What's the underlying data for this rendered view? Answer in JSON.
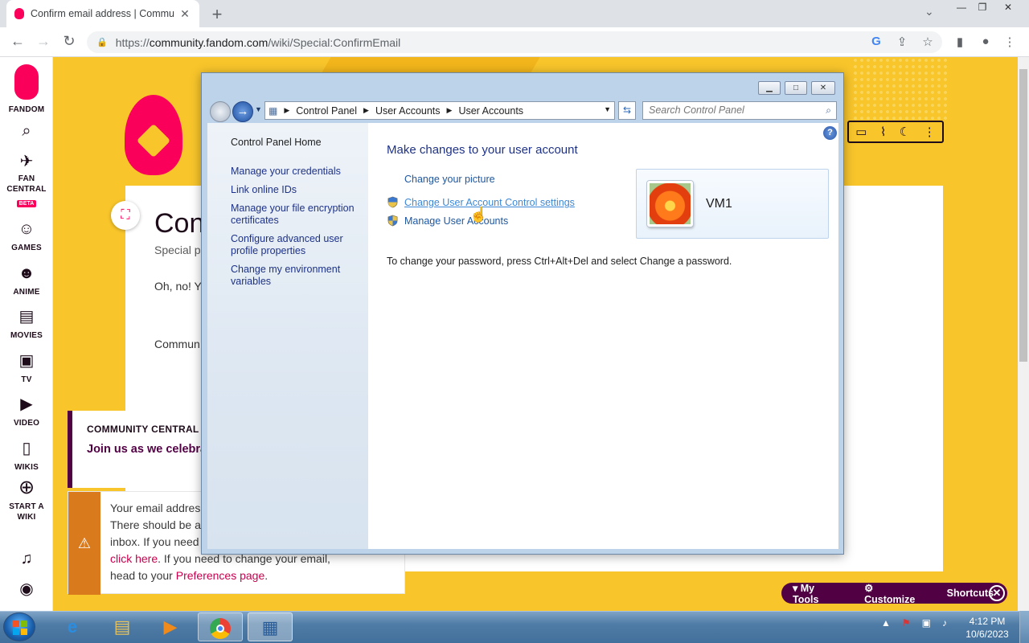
{
  "browser": {
    "tab_title": "Confirm email address | Commu",
    "url_prefix": "https://",
    "url_host": "community.fandom.com",
    "url_path": "/wiki/Special:ConfirmEmail"
  },
  "rail": {
    "brand": "FANDOM",
    "items": [
      {
        "label": "FAN CENTRAL",
        "badge": "BETA",
        "icon": "rocket-icon"
      },
      {
        "label": "GAMES",
        "icon": "gamepad-icon"
      },
      {
        "label": "ANIME",
        "icon": "anime-icon"
      },
      {
        "label": "MOVIES",
        "icon": "movie-icon"
      },
      {
        "label": "TV",
        "icon": "tv-icon"
      },
      {
        "label": "VIDEO",
        "icon": "video-icon"
      },
      {
        "label": "WIKIS",
        "icon": "book-icon"
      },
      {
        "label": "START A WIKI",
        "icon": "plus-icon"
      }
    ]
  },
  "article": {
    "title_fragment": "Con",
    "subtitle_fragment": "Special p",
    "p1_fragment": "Oh, no! Yo",
    "p2_fragment": "Commun"
  },
  "community": {
    "heading": "COMMUNITY CENTRAL",
    "body": "Join us as we celebra create stories for His"
  },
  "notification": {
    "line1": "Your email addres",
    "line2": "There should be a",
    "line3": "inbox. If you need",
    "link1": "click here",
    "after_link1": ". If you need to change your email,",
    "line5_pre": "head to your ",
    "link2": "Preferences page",
    "line5_post": "."
  },
  "tools": {
    "my_tools": "My Tools",
    "customize": "Customize",
    "shortcuts": "Shortcuts"
  },
  "control_panel": {
    "breadcrumb": [
      "Control Panel",
      "User Accounts",
      "User Accounts"
    ],
    "search_placeholder": "Search Control Panel",
    "left_links": [
      "Control Panel Home",
      "Manage your credentials",
      "Link online IDs",
      "Manage your file encryption certificates",
      "Configure advanced user profile properties",
      "Change my environment variables"
    ],
    "heading": "Make changes to your user account",
    "actions": [
      "Change your picture",
      "Change User Account Control settings",
      "Manage User Accounts"
    ],
    "password_note": "To change your password, press Ctrl+Alt+Del and select Change a password.",
    "user_name": "VM1"
  },
  "taskbar": {
    "time": "4:12 PM",
    "date": "10/6/2023"
  },
  "colors": {
    "fandom_yellow": "#f8c52b",
    "fandom_pink": "#fa005a",
    "fandom_purple": "#520044",
    "win_link": "#1e3287"
  }
}
